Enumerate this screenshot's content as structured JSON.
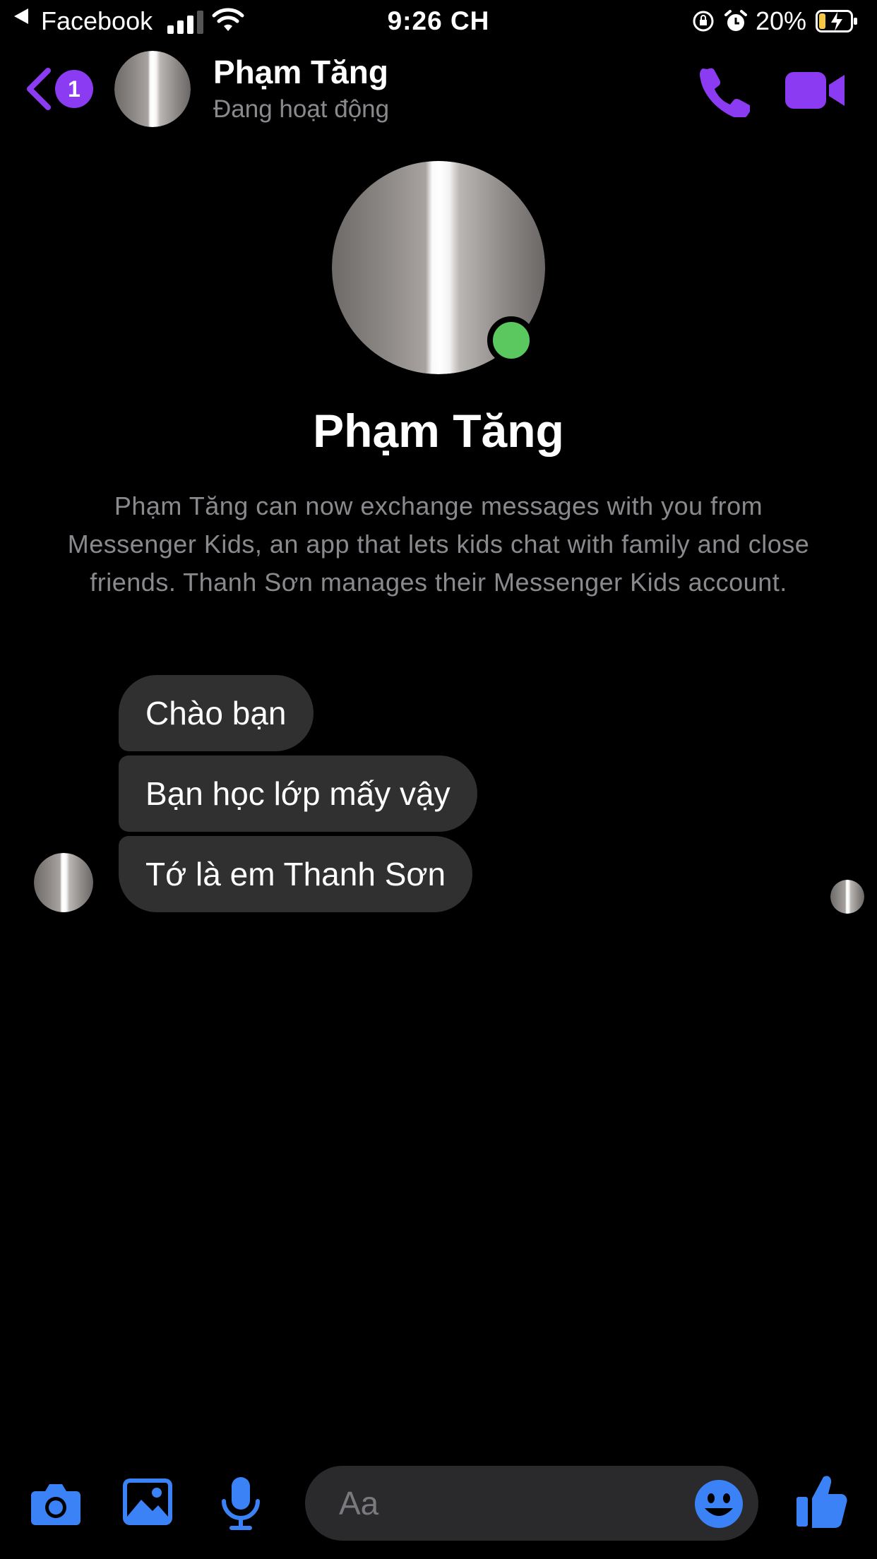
{
  "status_bar": {
    "back_app": "Facebook",
    "time": "9:26 CH",
    "battery_percent": "20%",
    "signal_bars": 3,
    "wifi_icon": "wifi-icon",
    "charging": true
  },
  "header": {
    "unread_badge": "1",
    "contact_name": "Phạm Tăng",
    "contact_status": "Đang hoạt động",
    "call_icon": "phone-icon",
    "video_icon": "video-camera-icon",
    "accent_color": "#8b3cf2"
  },
  "profile": {
    "name": "Phạm Tăng",
    "online": true,
    "info": "Phạm Tăng can now exchange messages with you from Messenger Kids, an app that lets kids chat with family and close friends. Thanh Sơn manages their Messenger Kids account."
  },
  "messages": [
    {
      "from": "Phạm Tăng",
      "text": "Chào bạn"
    },
    {
      "from": "Phạm Tăng",
      "text": "Bạn học lớp mấy vậy"
    },
    {
      "from": "Phạm Tăng",
      "text": "Tớ là em Thanh Sơn"
    }
  ],
  "composer": {
    "placeholder": "Aa",
    "icons": [
      "camera-icon",
      "image-icon",
      "microphone-icon",
      "emoji-icon",
      "thumbs-up-icon"
    ],
    "icon_color": "#3b82f6"
  }
}
